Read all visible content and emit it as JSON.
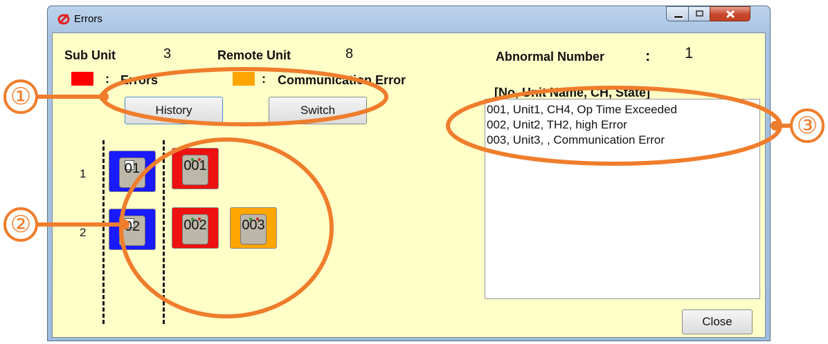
{
  "window": {
    "title": "Errors"
  },
  "header": {
    "sub_unit_label": "Sub Unit",
    "sub_unit_value": "3",
    "remote_unit_label": "Remote Unit",
    "remote_unit_value": "8",
    "abnormal_label": "Abnormal Number",
    "abnormal_sep": ":",
    "abnormal_value": "1"
  },
  "legend": [
    {
      "sep": ":",
      "label": "Errors",
      "color": "#ff0000"
    },
    {
      "sep": ":",
      "label": "Communication Error",
      "color": "#ffa500"
    }
  ],
  "buttons": {
    "history": "History",
    "switch": "Switch",
    "close": "Close"
  },
  "rows": [
    "1",
    "2"
  ],
  "units": {
    "sub_units": [
      {
        "code": "01",
        "color": "#1a1aff"
      },
      {
        "code": "02",
        "color": "#1a1aff"
      }
    ],
    "remote_units": [
      {
        "code": "001",
        "color": "#ee1111"
      },
      {
        "code": "002",
        "color": "#ee1111"
      },
      {
        "code": "003",
        "color": "#ffa500"
      }
    ]
  },
  "list": {
    "header": "[No, Unit Name, CH, State]",
    "items": [
      "001, Unit1, CH4, Op Time Exceeded",
      "002, Unit2, TH2, high Error",
      "003, Unit3, , Communication Error"
    ]
  },
  "callouts": [
    "①",
    "②",
    "③"
  ],
  "colors": {
    "callout": "#ef7d2c",
    "background": "#ffffc8"
  }
}
